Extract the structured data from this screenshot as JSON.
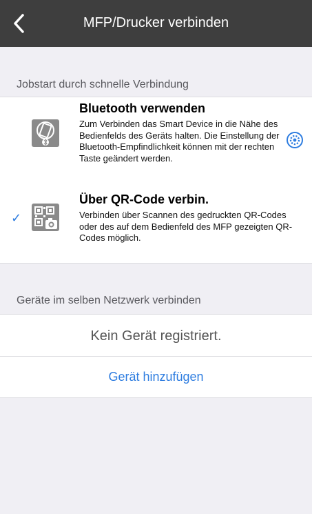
{
  "nav": {
    "title": "MFP/Drucker verbinden",
    "back_icon": "chevron-left-icon"
  },
  "section1": {
    "header": "Jobstart durch schnelle Verbindung",
    "options": [
      {
        "title": "Bluetooth verwenden",
        "desc": "Zum Verbinden das Smart Device in die Nähe des Bedienfelds des Geräts halten. Die Einstellung der Bluetooth-Empfindlichkeit können mit der rechten Taste geändert werden.",
        "icon": "bluetooth-phone-icon",
        "selected": false
      },
      {
        "title": "Über QR-Code verbin.",
        "desc": "Verbinden über Scannen des gedruckten QR-Codes oder des auf dem Bedienfeld des MFP gezeigten QR-Codes möglich.",
        "icon": "qr-camera-icon",
        "selected": true
      }
    ],
    "check_glyph": "✓"
  },
  "section2": {
    "header": "Geräte im selben Netzwerk verbinden",
    "empty_text": "Kein Gerät registriert.",
    "add_label": "Gerät hinzufügen"
  },
  "colors": {
    "accent": "#2e7de0",
    "navbar": "#3e3e3e",
    "background": "#f0eff4"
  }
}
